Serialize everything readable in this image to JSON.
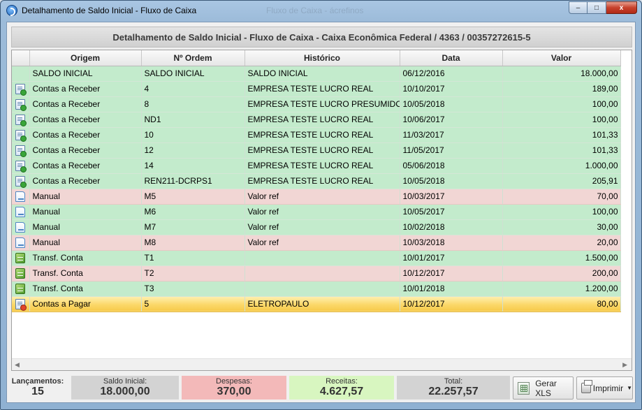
{
  "window": {
    "title": "Detalhamento de Saldo Inicial - Fluxo de Caixa",
    "background_title": "Fluxo de Caixa - ácrefinos",
    "minimize": "–",
    "maximize": "□",
    "close": "x"
  },
  "header": {
    "title": "Detalhamento de Saldo Inicial - Fluxo de Caixa - Caixa Econômica Federal / 4363 / 00357272615-5"
  },
  "table": {
    "columns": [
      "Origem",
      "Nº Ordem",
      "Histórico",
      "Data",
      "Valor"
    ],
    "rows": [
      {
        "icon": "",
        "origem": "SALDO INICIAL",
        "ordem": "SALDO INICIAL",
        "historico": "SALDO INICIAL",
        "data": "06/12/2016",
        "valor": "18.000,00",
        "status": "green"
      },
      {
        "icon": "contas-receber-icon",
        "origem": "Contas a Receber",
        "ordem": "4",
        "historico": "EMPRESA TESTE LUCRO REAL",
        "data": "10/10/2017",
        "valor": "189,00",
        "status": "green"
      },
      {
        "icon": "contas-receber-icon",
        "origem": "Contas a Receber",
        "ordem": "8",
        "historico": "EMPRESA TESTE LUCRO PRESUMIDO",
        "data": "10/05/2018",
        "valor": "100,00",
        "status": "green"
      },
      {
        "icon": "contas-receber-icon",
        "origem": "Contas a Receber",
        "ordem": "ND1",
        "historico": "EMPRESA TESTE LUCRO REAL",
        "data": "10/06/2017",
        "valor": "100,00",
        "status": "green"
      },
      {
        "icon": "contas-receber-icon",
        "origem": "Contas a Receber",
        "ordem": "10",
        "historico": "EMPRESA TESTE LUCRO REAL",
        "data": "11/03/2017",
        "valor": "101,33",
        "status": "green"
      },
      {
        "icon": "contas-receber-icon",
        "origem": "Contas a Receber",
        "ordem": "12",
        "historico": "EMPRESA TESTE LUCRO REAL",
        "data": "11/05/2017",
        "valor": "101,33",
        "status": "green"
      },
      {
        "icon": "contas-receber-icon",
        "origem": "Contas a Receber",
        "ordem": "14",
        "historico": "EMPRESA TESTE LUCRO REAL",
        "data": "05/06/2018",
        "valor": "1.000,00",
        "status": "green"
      },
      {
        "icon": "contas-receber-icon",
        "origem": "Contas a Receber",
        "ordem": "REN211-DCRPS1",
        "historico": "EMPRESA TESTE LUCRO REAL",
        "data": "10/05/2018",
        "valor": "205,91",
        "status": "green"
      },
      {
        "icon": "manual-document-icon",
        "origem": "Manual",
        "ordem": "M5",
        "historico": "Valor ref",
        "data": "10/03/2017",
        "valor": "70,00",
        "status": "red"
      },
      {
        "icon": "manual-document-icon",
        "origem": "Manual",
        "ordem": "M6",
        "historico": "Valor ref",
        "data": "10/05/2017",
        "valor": "100,00",
        "status": "green"
      },
      {
        "icon": "manual-document-icon",
        "origem": "Manual",
        "ordem": "M7",
        "historico": "Valor ref",
        "data": "10/02/2018",
        "valor": "30,00",
        "status": "green"
      },
      {
        "icon": "manual-document-icon",
        "origem": "Manual",
        "ordem": "M8",
        "historico": "Valor ref",
        "data": "10/03/2018",
        "valor": "20,00",
        "status": "red"
      },
      {
        "icon": "transfer-icon",
        "origem": "Transf. Conta",
        "ordem": "T1",
        "historico": "",
        "data": "10/01/2017",
        "valor": "1.500,00",
        "status": "green"
      },
      {
        "icon": "transfer-icon",
        "origem": "Transf. Conta",
        "ordem": "T2",
        "historico": "",
        "data": "10/12/2017",
        "valor": "200,00",
        "status": "red"
      },
      {
        "icon": "transfer-icon",
        "origem": "Transf. Conta",
        "ordem": "T3",
        "historico": "",
        "data": "10/01/2018",
        "valor": "1.200,00",
        "status": "green"
      },
      {
        "icon": "contas-pagar-icon",
        "origem": "Contas a Pagar",
        "ordem": "5",
        "historico": "ELETROPAULO",
        "data": "10/12/2017",
        "valor": "80,00",
        "status": "selected"
      }
    ]
  },
  "footer": {
    "lancamentos_label": "Lançamentos:",
    "lancamentos_value": "15",
    "saldo_label": "Saldo Inicial:",
    "saldo_value": "18.000,00",
    "despesas_label": "Despesas:",
    "despesas_value": "370,00",
    "receitas_label": "Receitas:",
    "receitas_value": "4.627,57",
    "total_label": "Total:",
    "total_value": "22.257,57",
    "xls_button": "Gerar XLS",
    "print_button": "Imprimir"
  },
  "colors": {
    "row_green": "#c3ebcc",
    "row_red": "#f1d6d4",
    "row_selected": "#fbd86a",
    "despesas_bg": "#f3b9b9",
    "receitas_bg": "#d8f6c0"
  }
}
